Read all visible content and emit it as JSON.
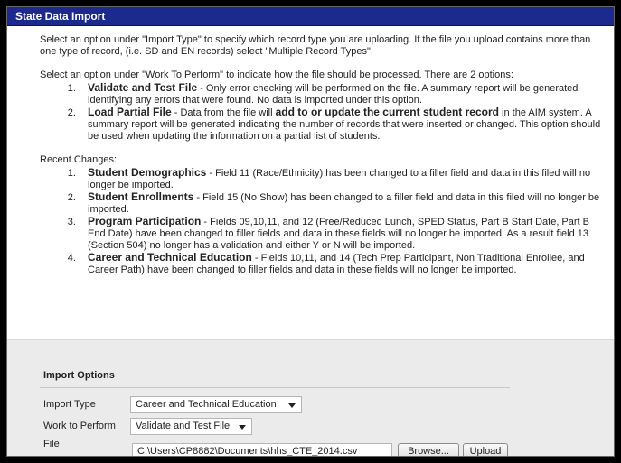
{
  "header": {
    "title": "State Data Import"
  },
  "intro": {
    "p1": "Select an option under \"Import Type\" to specify which record type you are uploading. If the file you upload contains more than one type of record, (i.e. SD and EN records) select \"Multiple Record Types\".",
    "p2": "Select an option under \"Work To Perform\" to indicate how the file should be processed. There are 2 options:",
    "options": [
      {
        "title": "Validate and Test File",
        "text": " - Only error checking will be performed on the file. A summary report will be generated identifying any errors that were found. No data is imported under this option."
      },
      {
        "title": "Load Partial File",
        "text_before": " - Data from the file will ",
        "bold_mid": "add to or update the current student record",
        "text_after": " in the AIM system. A summary report will be generated indicating the number of records that were inserted or changed. This option should be used when updating the information on a partial list of students."
      }
    ]
  },
  "recent": {
    "label": "Recent Changes:",
    "items": [
      {
        "title": "Student Demographics",
        "text": " - Field 11 (Race/Ethnicity) has been changed to a filler field and data in this filed will no longer be imported."
      },
      {
        "title": "Student Enrollments",
        "text": " - Field 15 (No Show) has been changed to a filler field and data in this filed will no longer be imported."
      },
      {
        "title": "Program Participation",
        "text": " - Fields 09,10,11, and 12 (Free/Reduced Lunch, SPED Status, Part B Start Date, Part B End Date) have been changed to filler fields and data in these fields will no longer be imported. As a result field 13 (Section 504) no longer has a validation and either Y or N will be imported."
      },
      {
        "title": "Career and Technical Education",
        "text": " - Fields 10,11, and 14 (Tech Prep Participant, Non Traditional Enrollee, and Career Path) have been changed to filler fields and data in these fields will no longer be imported."
      }
    ]
  },
  "import_options": {
    "title": "Import Options",
    "import_type_label": "Import Type",
    "import_type_value": "Career and Technical Education",
    "work_label": "Work to Perform",
    "work_value": "Validate and Test File",
    "file_label": "File",
    "file_value": "C:\\Users\\CP8882\\Documents\\hhs_CTE_2014.csv",
    "browse_label": "Browse...",
    "upload_label": "Upload"
  },
  "colors": {
    "title_bar": "#1b2a8c",
    "options_bg": "#ebebeb"
  }
}
